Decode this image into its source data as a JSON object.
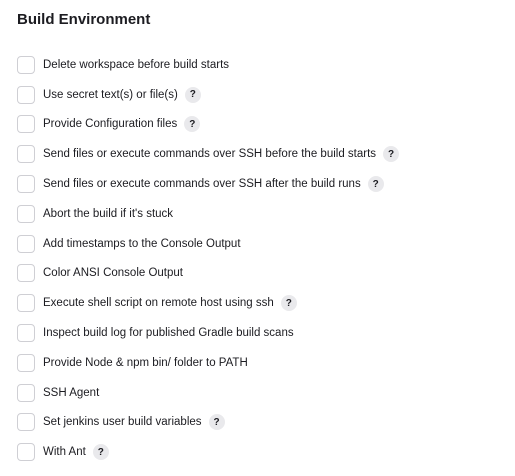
{
  "section": {
    "title": "Build Environment"
  },
  "options": [
    {
      "label": "Delete workspace before build starts",
      "checked": false,
      "has_help": false
    },
    {
      "label": "Use secret text(s) or file(s)",
      "checked": false,
      "has_help": true
    },
    {
      "label": "Provide Configuration files",
      "checked": false,
      "has_help": true
    },
    {
      "label": "Send files or execute commands over SSH before the build starts",
      "checked": false,
      "has_help": true
    },
    {
      "label": "Send files or execute commands over SSH after the build runs",
      "checked": false,
      "has_help": true
    },
    {
      "label": "Abort the build if it's stuck",
      "checked": false,
      "has_help": false
    },
    {
      "label": "Add timestamps to the Console Output",
      "checked": false,
      "has_help": false
    },
    {
      "label": "Color ANSI Console Output",
      "checked": false,
      "has_help": false
    },
    {
      "label": "Execute shell script on remote host using ssh",
      "checked": false,
      "has_help": true
    },
    {
      "label": "Inspect build log for published Gradle build scans",
      "checked": false,
      "has_help": false
    },
    {
      "label": "Provide Node & npm bin/ folder to PATH",
      "checked": false,
      "has_help": false
    },
    {
      "label": "SSH Agent",
      "checked": false,
      "has_help": false
    },
    {
      "label": "Set jenkins user build variables",
      "checked": false,
      "has_help": true
    },
    {
      "label": "With Ant",
      "checked": false,
      "has_help": true
    }
  ],
  "help_glyph": "?",
  "icons": {
    "help": "question-mark-icon"
  }
}
